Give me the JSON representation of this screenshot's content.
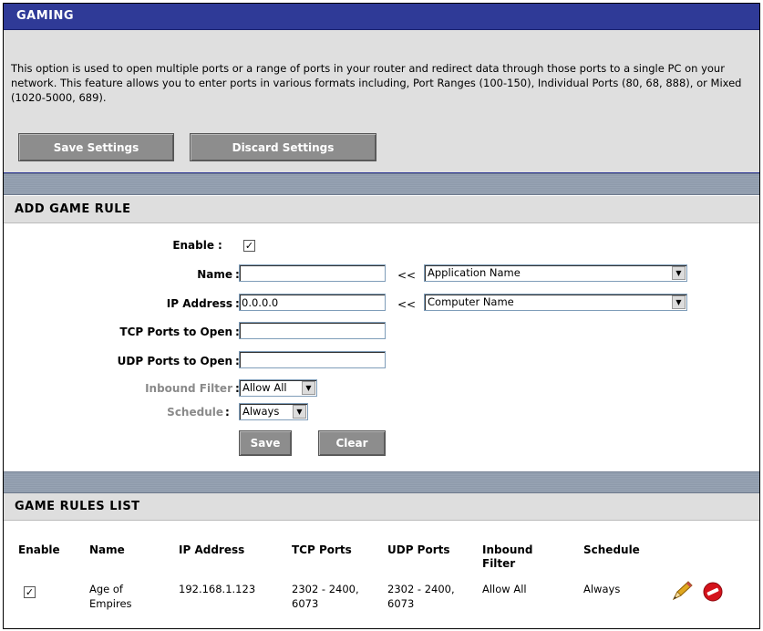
{
  "page": {
    "title": "GAMING",
    "description": "This option is used to open multiple ports or a range of ports in your router and redirect data through those ports to a single PC on your network. This feature allows you to enter ports in various formats including, Port Ranges (100-150), Individual Ports (80, 68, 888), or Mixed (1020-5000, 689).",
    "save_settings": "Save Settings",
    "discard_settings": "Discard Settings"
  },
  "add_rule": {
    "heading": "ADD GAME RULE",
    "enable_label": "Enable",
    "enable_checked": true,
    "name_label": "Name",
    "name_value": "",
    "ip_label": "IP Address",
    "ip_value": "0.0.0.0",
    "tcp_label": "TCP Ports to Open",
    "tcp_value": "",
    "udp_label": "UDP Ports to Open",
    "udp_value": "",
    "inbound_label": "Inbound Filter",
    "inbound_value": "Allow All",
    "schedule_label": "Schedule",
    "schedule_value": "Always",
    "arrow_text": "<<",
    "app_select": "Application Name",
    "computer_select": "Computer Name",
    "save_button": "Save",
    "clear_button": "Clear",
    "colon": ":"
  },
  "rules_list": {
    "heading": "GAME RULES LIST",
    "columns": [
      "Enable",
      "Name",
      "IP Address",
      "TCP Ports",
      "UDP Ports",
      "Inbound Filter",
      "Schedule"
    ],
    "rows": [
      {
        "enabled": true,
        "name": "Age of Empires",
        "ip": "192.168.1.123",
        "tcp": "2302 - 2400, 6073",
        "udp": "2302 - 2400, 6073",
        "inbound": "Allow All",
        "schedule": "Always",
        "edit_icon": "pencil-icon",
        "delete_icon": "delete-icon"
      }
    ]
  },
  "colors": {
    "title_bar": "#2f3a97",
    "button_gray": "#8d8d8d",
    "separator": "#97a3b3",
    "delete_red": "#d4121b"
  }
}
